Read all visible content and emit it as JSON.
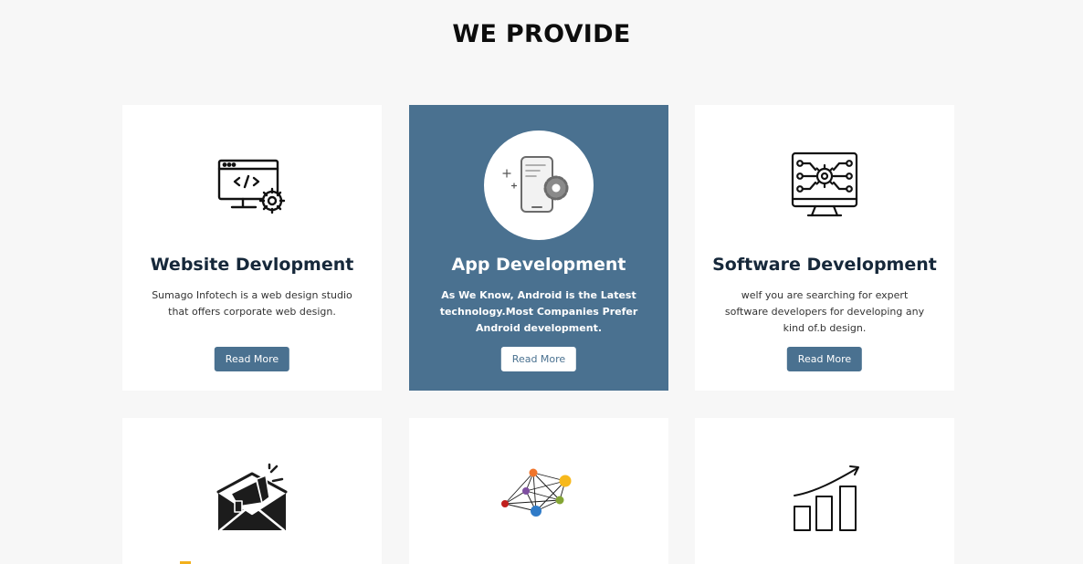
{
  "section": {
    "title": "WE PROVIDE"
  },
  "cards": [
    {
      "title": "Website Devlopment",
      "text": "Sumago Infotech is a web design studio that offers corporate web design.",
      "button": "Read More",
      "icon": "web-code-gear-icon"
    },
    {
      "title": "App Development",
      "text": "As We Know, Android is the Latest technology.Most Companies Prefer Android development.",
      "button": "Read More",
      "icon": "mobile-gear-icon"
    },
    {
      "title": "Software Development",
      "text": "welf you are searching for expert software developers for developing any kind of.b design.",
      "button": "Read More",
      "icon": "circuit-gear-monitor-icon"
    }
  ],
  "lower_cards": [
    {
      "icon": "email-megaphone-icon"
    },
    {
      "icon": "network-nodes-icon"
    },
    {
      "icon": "growth-chart-icon"
    }
  ],
  "colors": {
    "accent": "#4a7190",
    "background": "#f7f7f7",
    "card": "#ffffff",
    "node_colors": [
      "#f0752b",
      "#f7b91d",
      "#7e4fa0",
      "#84a534",
      "#c0201e",
      "#2f7bc8"
    ]
  }
}
